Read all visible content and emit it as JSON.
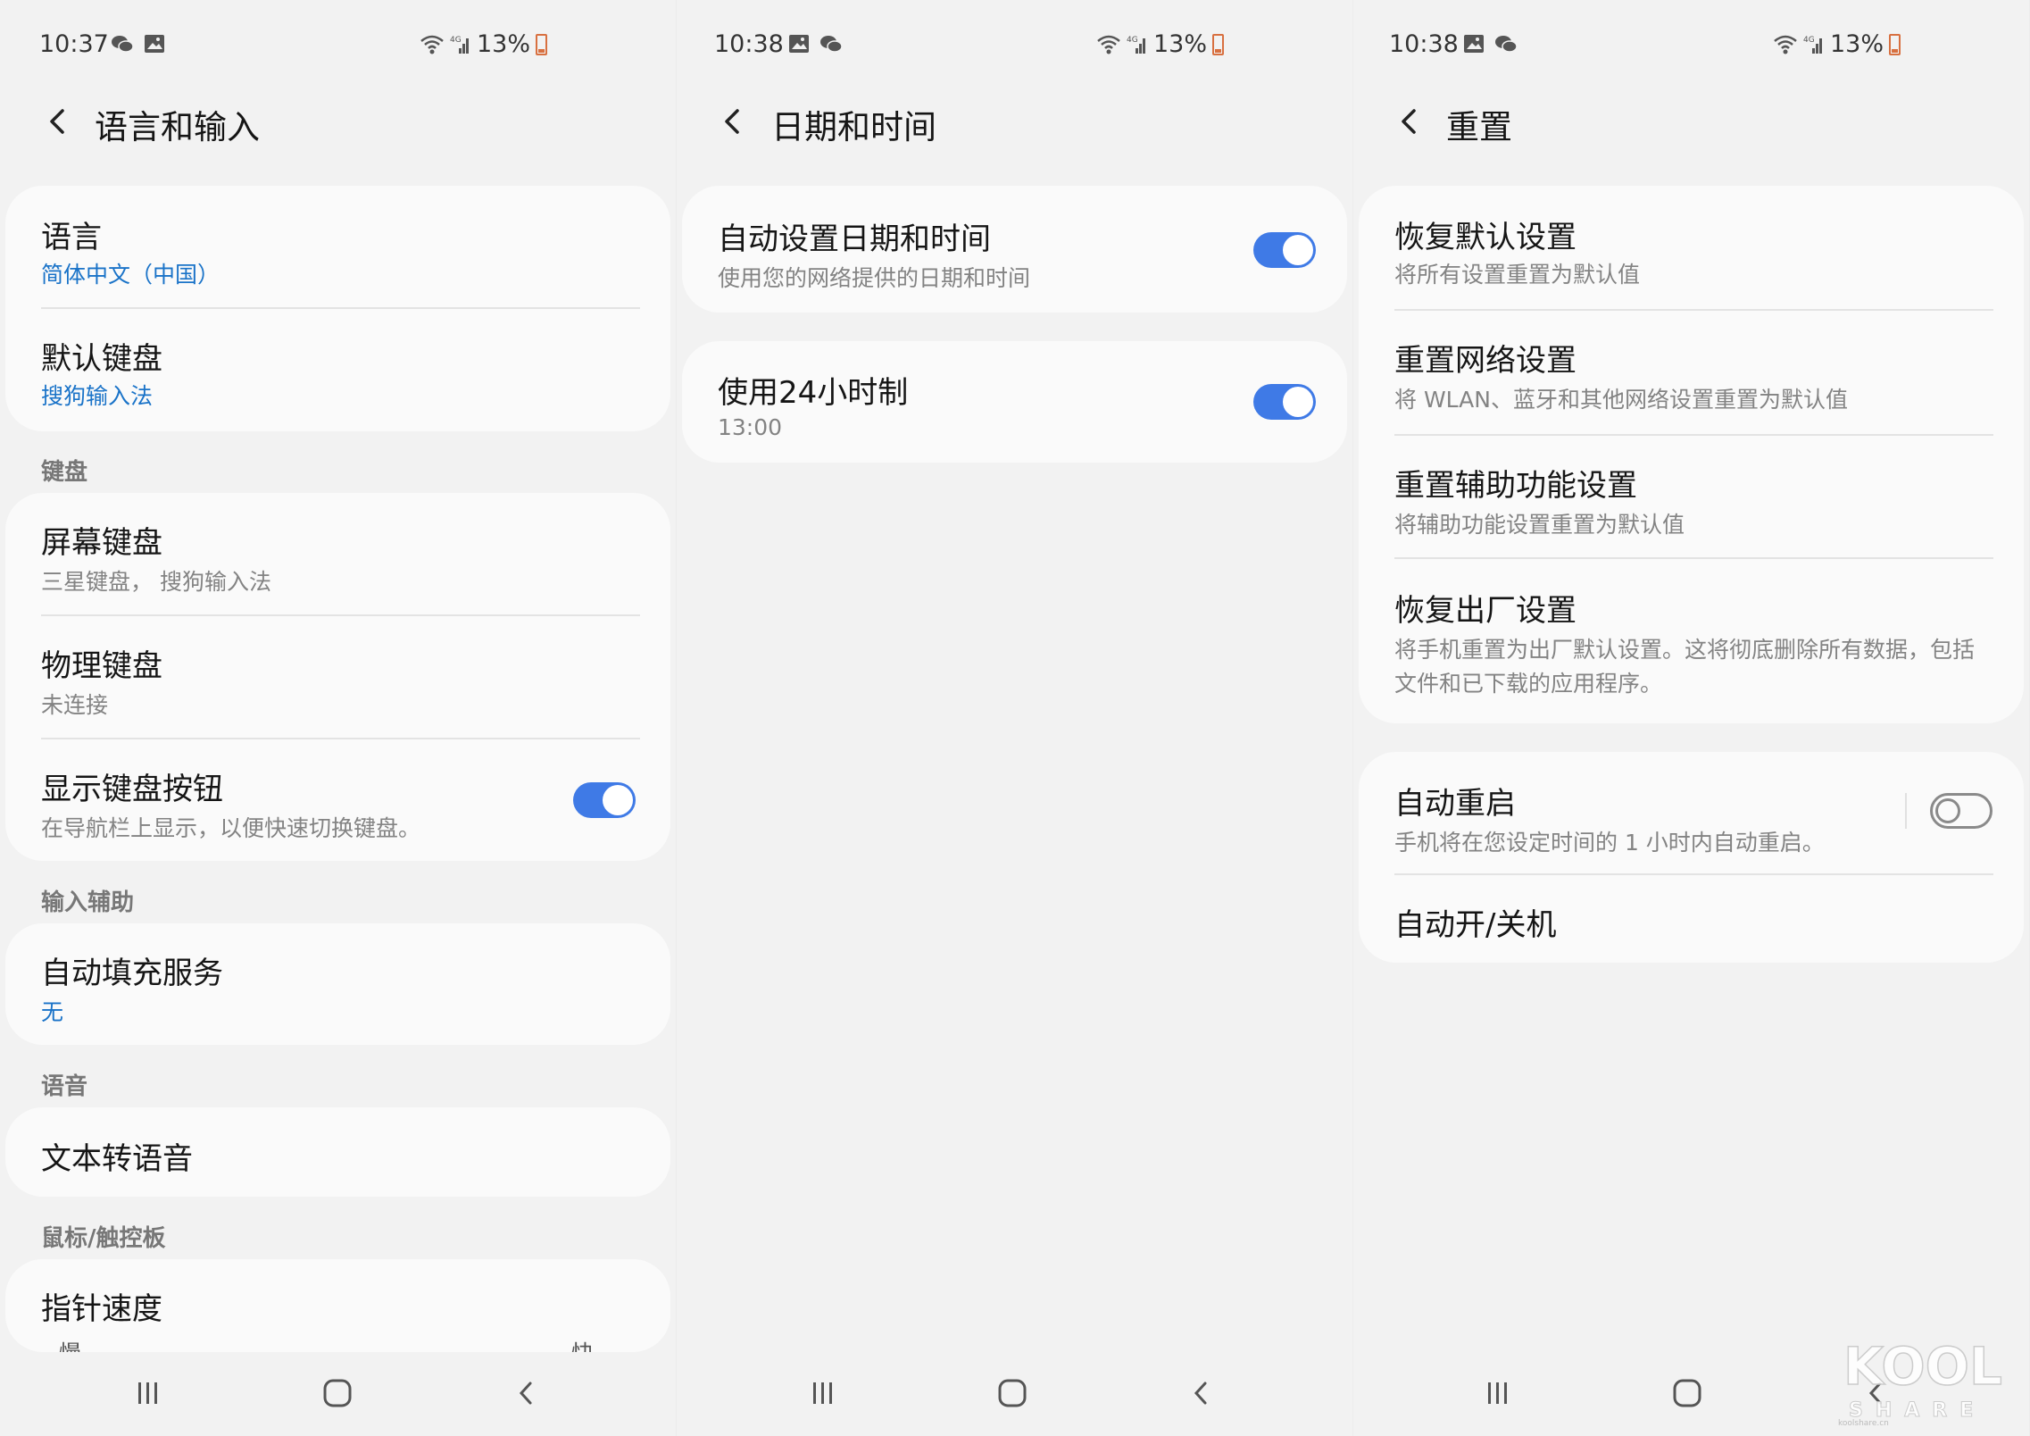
{
  "screens": [
    {
      "status": {
        "time": "10:37",
        "battery": "13%"
      },
      "title": "语言和输入",
      "group1": {
        "language": {
          "title": "语言",
          "value": "简体中文（中国）"
        },
        "default_keyboard": {
          "title": "默认键盘",
          "value": "搜狗输入法"
        }
      },
      "section_keyboard": "键盘",
      "group2": {
        "onscreen": {
          "title": "屏幕键盘",
          "sub": "三星键盘， 搜狗输入法"
        },
        "physical": {
          "title": "物理键盘",
          "sub": "未连接"
        },
        "show_button": {
          "title": "显示键盘按钮",
          "sub": "在导航栏上显示，以便快速切换键盘。",
          "on": true
        }
      },
      "section_input_assist": "输入辅助",
      "autofill": {
        "title": "自动填充服务",
        "value": "无"
      },
      "section_speech": "语音",
      "tts": {
        "title": "文本转语音"
      },
      "section_mouse": "鼠标/触控板",
      "pointer": {
        "title": "指针速度",
        "slow": "慢",
        "fast": "快"
      }
    },
    {
      "status": {
        "time": "10:38",
        "battery": "13%"
      },
      "title": "日期和时间",
      "auto_datetime": {
        "title": "自动设置日期和时间",
        "sub": "使用您的网络提供的日期和时间",
        "on": true
      },
      "use_24h": {
        "title": "使用24小时制",
        "sub": "13:00",
        "on": true
      }
    },
    {
      "status": {
        "time": "10:38",
        "battery": "13%"
      },
      "title": "重置",
      "items": [
        {
          "title": "恢复默认设置",
          "sub": "将所有设置重置为默认值"
        },
        {
          "title": "重置网络设置",
          "sub": "将 WLAN、蓝牙和其他网络设置重置为默认值"
        },
        {
          "title": "重置辅助功能设置",
          "sub": "将辅助功能设置重置为默认值"
        },
        {
          "title": "恢复出厂设置",
          "sub1": "将手机重置为出厂默认设置。这将彻底删除所有数据，包括",
          "sub2": "文件和已下载的应用程序。"
        }
      ],
      "auto_restart": {
        "title": "自动重启",
        "sub": "手机将在您设定时间的 1 小时内自动重启。",
        "on": false
      },
      "auto_power": {
        "title": "自动开/关机"
      }
    }
  ],
  "colors": {
    "accent": "#3f7ae6",
    "link": "#1a73c8",
    "background": "#f2f2f2",
    "card": "#fafafa"
  },
  "watermark": {
    "text": "KOOL SHARE",
    "site": "koolshare.cn"
  }
}
